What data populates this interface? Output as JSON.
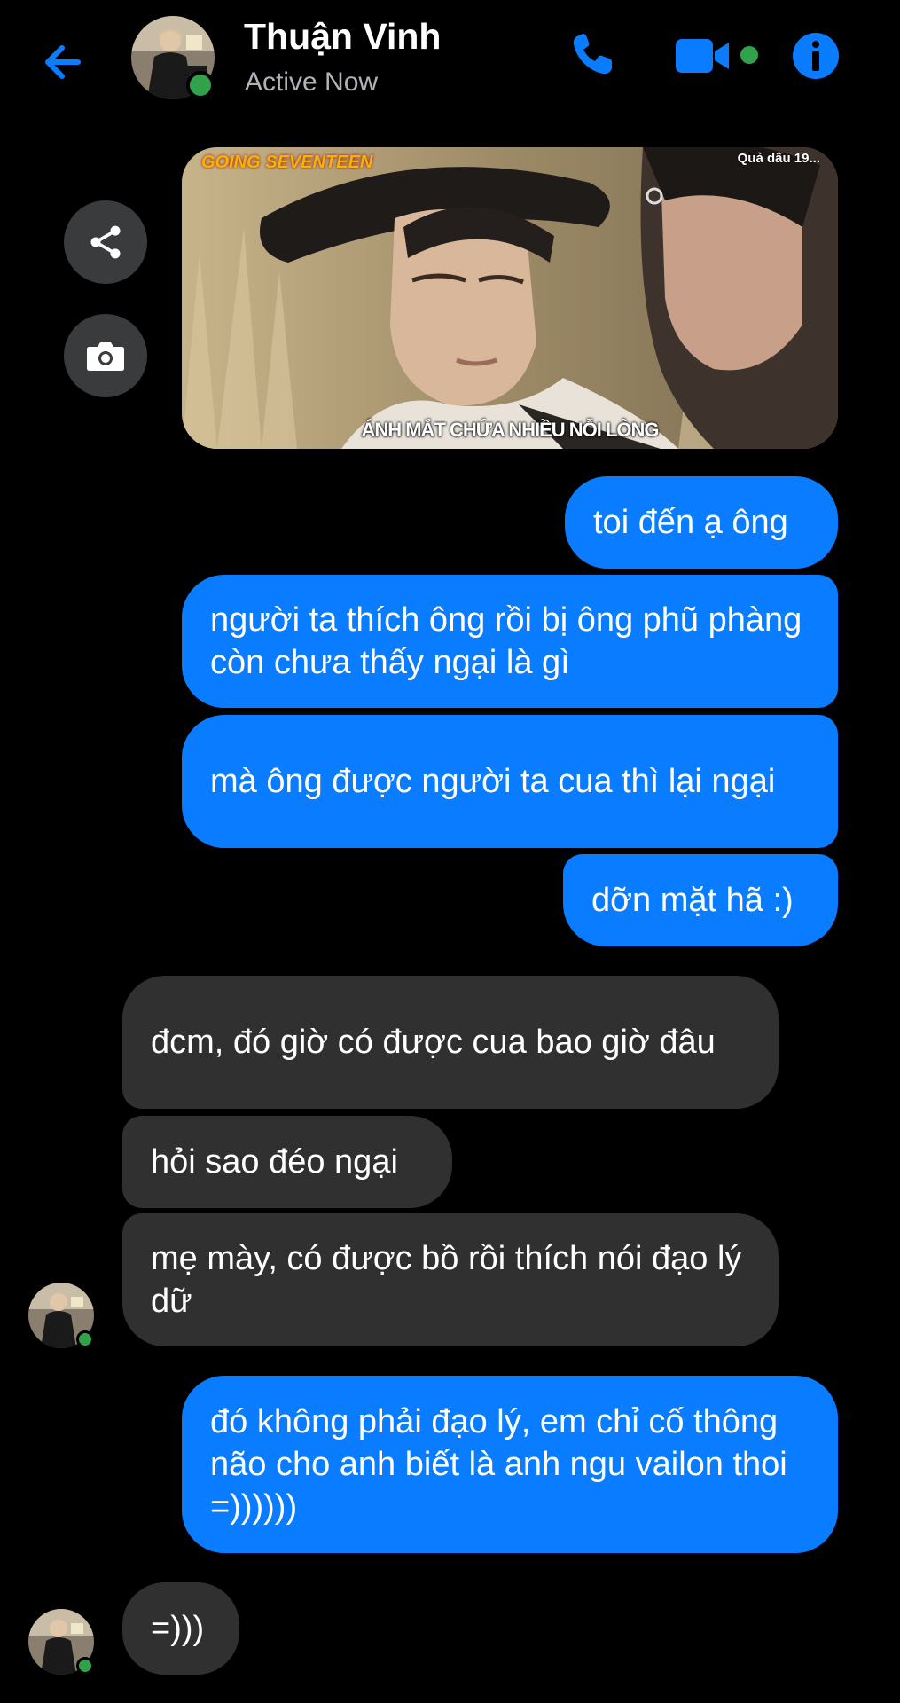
{
  "header": {
    "name": "Thuận Vinh",
    "status": "Active Now",
    "icons": {
      "back": "back-arrow-icon",
      "call": "phone-icon",
      "video": "video-camera-icon",
      "info": "info-icon"
    },
    "colors": {
      "accent": "#0a7cff",
      "online": "#31a24c"
    }
  },
  "image_message": {
    "caption": "ÁNH MẮT CHỨA NHIỀU NỖI LÒNG",
    "logo_text": "GOING SEVENTEEN",
    "corner_text": "Quả dâu 19..."
  },
  "side_actions": {
    "share_icon": "share-icon",
    "camera_icon": "camera-icon"
  },
  "messages": [
    {
      "sender": "me",
      "text": "toi đến ạ ông"
    },
    {
      "sender": "me",
      "text": "người ta thích ông rồi bị ông phũ phàng còn chưa thấy ngại là gì"
    },
    {
      "sender": "me",
      "text": "mà ông được người ta cua thì lại ngại"
    },
    {
      "sender": "me",
      "text": "dỡn mặt hã :)"
    },
    {
      "sender": "contact",
      "text": "đcm, đó giờ có được cua bao giờ đâu"
    },
    {
      "sender": "contact",
      "text": "hỏi sao đéo ngại"
    },
    {
      "sender": "contact",
      "text": "mẹ mày, có được bồ rồi thích nói đạo lý dữ"
    },
    {
      "sender": "me",
      "text": "đó không phải đạo lý, em chỉ cố thông não cho anh biết là anh ngu vailon thoi =))))))"
    },
    {
      "sender": "contact",
      "text": "=)))"
    }
  ]
}
